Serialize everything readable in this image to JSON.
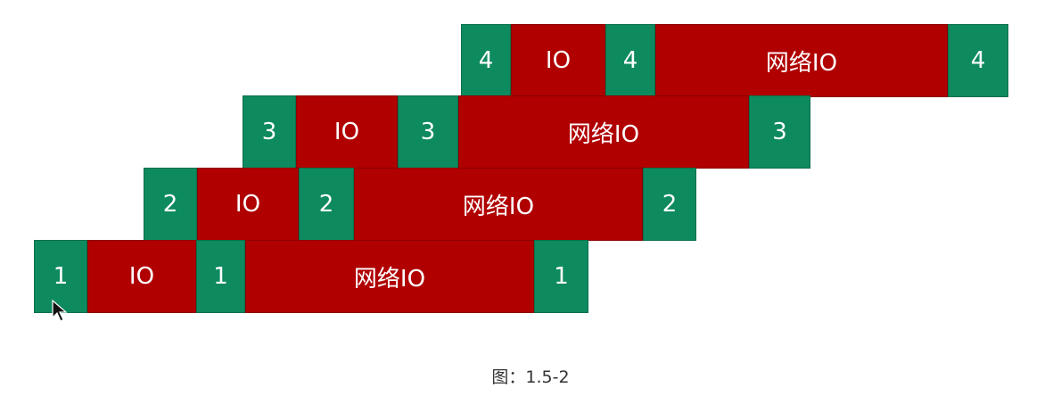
{
  "rows": [
    {
      "segments": [
        {
          "kind": "cpu",
          "label": "4"
        },
        {
          "kind": "io",
          "label": "IO"
        },
        {
          "kind": "cpu",
          "label": "4"
        },
        {
          "kind": "io",
          "label": "网络IO"
        },
        {
          "kind": "cpu",
          "label": "4"
        }
      ]
    },
    {
      "segments": [
        {
          "kind": "cpu",
          "label": "3"
        },
        {
          "kind": "io",
          "label": "IO"
        },
        {
          "kind": "cpu",
          "label": "3"
        },
        {
          "kind": "io",
          "label": "网络IO"
        },
        {
          "kind": "cpu",
          "label": "3"
        }
      ]
    },
    {
      "segments": [
        {
          "kind": "cpu",
          "label": "2"
        },
        {
          "kind": "io",
          "label": "IO"
        },
        {
          "kind": "cpu",
          "label": "2"
        },
        {
          "kind": "io",
          "label": "网络IO"
        },
        {
          "kind": "cpu",
          "label": "2"
        }
      ]
    },
    {
      "segments": [
        {
          "kind": "cpu",
          "label": "1"
        },
        {
          "kind": "io",
          "label": "IO"
        },
        {
          "kind": "cpu",
          "label": "1"
        },
        {
          "kind": "io",
          "label": "网络IO"
        },
        {
          "kind": "cpu",
          "label": "1"
        }
      ]
    }
  ],
  "colors": {
    "cpu": "#0e8a5f",
    "io": "#b00000"
  },
  "caption": "图：1.5-2"
}
